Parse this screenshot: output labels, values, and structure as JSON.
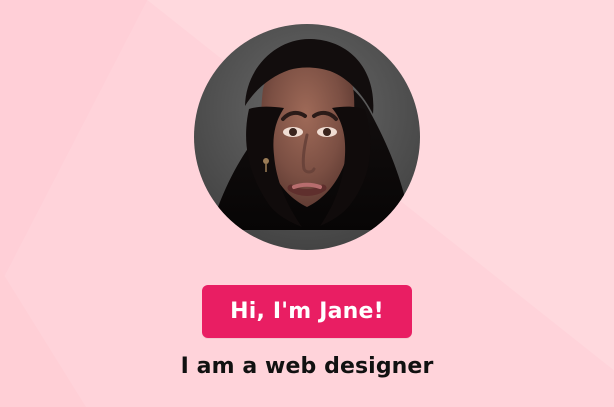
{
  "profile": {
    "greeting": "Hi, I'm Jane!",
    "tagline": "I am a web designer",
    "avatar_icon": "profile-photo"
  },
  "colors": {
    "accent": "#e91e63",
    "background": "#ffd3da",
    "text": "#111111"
  }
}
